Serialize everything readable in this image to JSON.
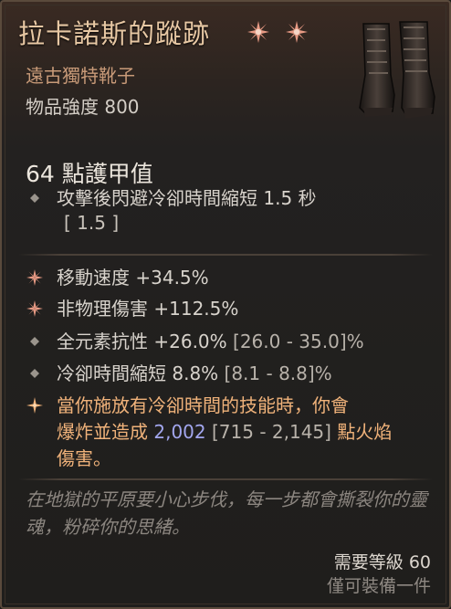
{
  "item": {
    "name": "拉卡諾斯的蹤跡",
    "subtype": "遠古獨特靴子",
    "item_power": "物品強度 800",
    "socket_icons": [
      "socket-gem-icon",
      "socket-gem-icon"
    ],
    "art_icon": "boots-icon"
  },
  "armor": "64 點護甲值",
  "implicit": {
    "text": "攻擊後閃避冷卻時間縮短 1.5 秒",
    "range": "[ 1.5 ]"
  },
  "affixes": [
    {
      "text": "移動速度 +34.5%",
      "range": "",
      "icon": "greater-affix-icon"
    },
    {
      "text": "非物理傷害 +112.5%",
      "range": "",
      "icon": "greater-affix-icon"
    },
    {
      "text": "全元素抗性 +26.0%",
      "range": "[26.0 - 35.0]%",
      "icon": "affix-diamond-icon"
    },
    {
      "text": "冷卻時間縮短 8.8%",
      "range": "[8.1 - 8.8]%",
      "icon": "affix-diamond-icon"
    }
  ],
  "unique_power": {
    "line1": "當你施放有冷卻時間的技能時，你會",
    "line2_prefix": "爆炸並造成 ",
    "value": "2,002",
    "range": " [715 - 2,145] ",
    "line2_suffix": "點火焰",
    "line3": "傷害。",
    "icon": "unique-star-icon"
  },
  "flavor": "在地獄的平原要小心步伐，每一步都會撕裂你的靈魂，粉碎你的思緒。",
  "requirement": "需要等級 60",
  "unique_equipped": "僅可裝備一件",
  "colors": {
    "title": "#e8c8a4",
    "subtype": "#c89a78",
    "legendary": "#f0b27a",
    "value_blue": "#a2a6ee",
    "flavor": "#8c8680"
  }
}
